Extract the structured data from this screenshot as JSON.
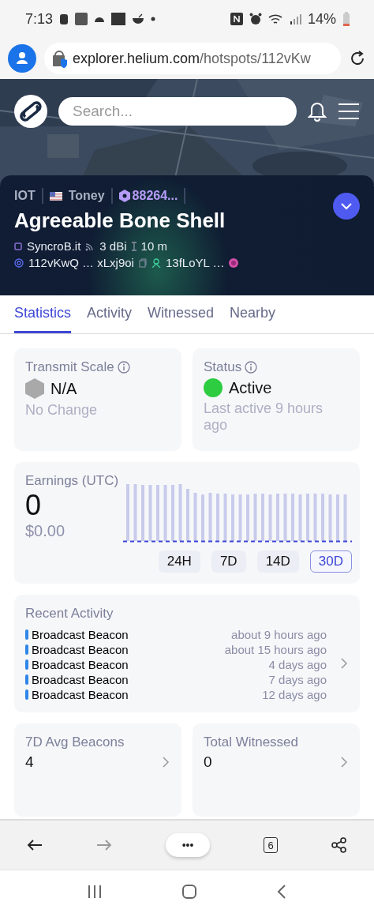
{
  "status_bar": {
    "time": "7:13",
    "battery": "14%"
  },
  "address_bar": {
    "host": "explorer.helium.com",
    "path": "/hotspots/112vKw"
  },
  "header": {
    "search": {
      "placeholder": "Search..."
    }
  },
  "hotspot": {
    "network": "IOT",
    "location": "Toney",
    "hex": "88264...",
    "name": "Agreeable Bone Shell",
    "maker": "SyncroB.it",
    "gain": "3 dBi",
    "elevation": "10 m",
    "address": "112vKwQ … xLxj9oi",
    "owner": "13fLoYL …"
  },
  "tabs": [
    {
      "label": "Statistics",
      "selected": true
    },
    {
      "label": "Activity",
      "selected": false
    },
    {
      "label": "Witnessed",
      "selected": false
    },
    {
      "label": "Nearby",
      "selected": false
    }
  ],
  "transmit_scale": {
    "title": "Transmit Scale",
    "value": "N/A",
    "note": "No Change"
  },
  "status": {
    "title": "Status",
    "value": "Active",
    "note": "Last active 9 hours ago"
  },
  "earnings": {
    "title": "Earnings (UTC)",
    "value": "0",
    "usd": "$0.00",
    "ranges": [
      {
        "label": "24H",
        "selected": false
      },
      {
        "label": "7D",
        "selected": false
      },
      {
        "label": "14D",
        "selected": false
      },
      {
        "label": "30D",
        "selected": true
      }
    ]
  },
  "recent_activity": {
    "title": "Recent Activity",
    "items": [
      {
        "label": "Broadcast Beacon",
        "time": "about 9 hours ago"
      },
      {
        "label": "Broadcast Beacon",
        "time": "about 15 hours ago"
      },
      {
        "label": "Broadcast Beacon",
        "time": "4 days ago"
      },
      {
        "label": "Broadcast Beacon",
        "time": "7 days ago"
      },
      {
        "label": "Broadcast Beacon",
        "time": "12 days ago"
      }
    ]
  },
  "stats": [
    {
      "title": "7D Avg Beacons",
      "value": "4"
    },
    {
      "title": "Total Witnessed",
      "value": "0"
    }
  ],
  "browser_toolbar": {
    "menu": "•••",
    "tab_count": "6"
  }
}
